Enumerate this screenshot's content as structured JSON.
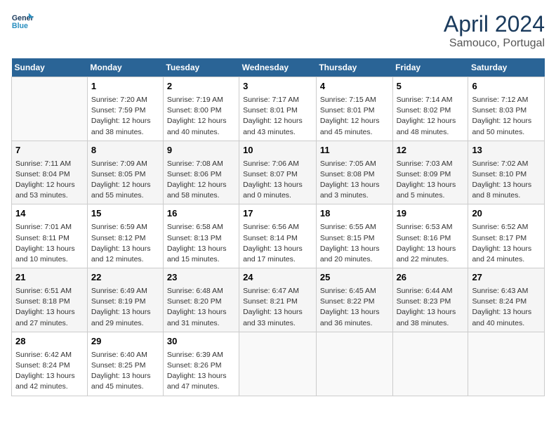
{
  "header": {
    "logo_line1": "General",
    "logo_line2": "Blue",
    "month": "April 2024",
    "location": "Samouco, Portugal"
  },
  "columns": [
    "Sunday",
    "Monday",
    "Tuesday",
    "Wednesday",
    "Thursday",
    "Friday",
    "Saturday"
  ],
  "rows": [
    [
      {
        "day": "",
        "info": ""
      },
      {
        "day": "1",
        "info": "Sunrise: 7:20 AM\nSunset: 7:59 PM\nDaylight: 12 hours\nand 38 minutes."
      },
      {
        "day": "2",
        "info": "Sunrise: 7:19 AM\nSunset: 8:00 PM\nDaylight: 12 hours\nand 40 minutes."
      },
      {
        "day": "3",
        "info": "Sunrise: 7:17 AM\nSunset: 8:01 PM\nDaylight: 12 hours\nand 43 minutes."
      },
      {
        "day": "4",
        "info": "Sunrise: 7:15 AM\nSunset: 8:01 PM\nDaylight: 12 hours\nand 45 minutes."
      },
      {
        "day": "5",
        "info": "Sunrise: 7:14 AM\nSunset: 8:02 PM\nDaylight: 12 hours\nand 48 minutes."
      },
      {
        "day": "6",
        "info": "Sunrise: 7:12 AM\nSunset: 8:03 PM\nDaylight: 12 hours\nand 50 minutes."
      }
    ],
    [
      {
        "day": "7",
        "info": "Sunrise: 7:11 AM\nSunset: 8:04 PM\nDaylight: 12 hours\nand 53 minutes."
      },
      {
        "day": "8",
        "info": "Sunrise: 7:09 AM\nSunset: 8:05 PM\nDaylight: 12 hours\nand 55 minutes."
      },
      {
        "day": "9",
        "info": "Sunrise: 7:08 AM\nSunset: 8:06 PM\nDaylight: 12 hours\nand 58 minutes."
      },
      {
        "day": "10",
        "info": "Sunrise: 7:06 AM\nSunset: 8:07 PM\nDaylight: 13 hours\nand 0 minutes."
      },
      {
        "day": "11",
        "info": "Sunrise: 7:05 AM\nSunset: 8:08 PM\nDaylight: 13 hours\nand 3 minutes."
      },
      {
        "day": "12",
        "info": "Sunrise: 7:03 AM\nSunset: 8:09 PM\nDaylight: 13 hours\nand 5 minutes."
      },
      {
        "day": "13",
        "info": "Sunrise: 7:02 AM\nSunset: 8:10 PM\nDaylight: 13 hours\nand 8 minutes."
      }
    ],
    [
      {
        "day": "14",
        "info": "Sunrise: 7:01 AM\nSunset: 8:11 PM\nDaylight: 13 hours\nand 10 minutes."
      },
      {
        "day": "15",
        "info": "Sunrise: 6:59 AM\nSunset: 8:12 PM\nDaylight: 13 hours\nand 12 minutes."
      },
      {
        "day": "16",
        "info": "Sunrise: 6:58 AM\nSunset: 8:13 PM\nDaylight: 13 hours\nand 15 minutes."
      },
      {
        "day": "17",
        "info": "Sunrise: 6:56 AM\nSunset: 8:14 PM\nDaylight: 13 hours\nand 17 minutes."
      },
      {
        "day": "18",
        "info": "Sunrise: 6:55 AM\nSunset: 8:15 PM\nDaylight: 13 hours\nand 20 minutes."
      },
      {
        "day": "19",
        "info": "Sunrise: 6:53 AM\nSunset: 8:16 PM\nDaylight: 13 hours\nand 22 minutes."
      },
      {
        "day": "20",
        "info": "Sunrise: 6:52 AM\nSunset: 8:17 PM\nDaylight: 13 hours\nand 24 minutes."
      }
    ],
    [
      {
        "day": "21",
        "info": "Sunrise: 6:51 AM\nSunset: 8:18 PM\nDaylight: 13 hours\nand 27 minutes."
      },
      {
        "day": "22",
        "info": "Sunrise: 6:49 AM\nSunset: 8:19 PM\nDaylight: 13 hours\nand 29 minutes."
      },
      {
        "day": "23",
        "info": "Sunrise: 6:48 AM\nSunset: 8:20 PM\nDaylight: 13 hours\nand 31 minutes."
      },
      {
        "day": "24",
        "info": "Sunrise: 6:47 AM\nSunset: 8:21 PM\nDaylight: 13 hours\nand 33 minutes."
      },
      {
        "day": "25",
        "info": "Sunrise: 6:45 AM\nSunset: 8:22 PM\nDaylight: 13 hours\nand 36 minutes."
      },
      {
        "day": "26",
        "info": "Sunrise: 6:44 AM\nSunset: 8:23 PM\nDaylight: 13 hours\nand 38 minutes."
      },
      {
        "day": "27",
        "info": "Sunrise: 6:43 AM\nSunset: 8:24 PM\nDaylight: 13 hours\nand 40 minutes."
      }
    ],
    [
      {
        "day": "28",
        "info": "Sunrise: 6:42 AM\nSunset: 8:24 PM\nDaylight: 13 hours\nand 42 minutes."
      },
      {
        "day": "29",
        "info": "Sunrise: 6:40 AM\nSunset: 8:25 PM\nDaylight: 13 hours\nand 45 minutes."
      },
      {
        "day": "30",
        "info": "Sunrise: 6:39 AM\nSunset: 8:26 PM\nDaylight: 13 hours\nand 47 minutes."
      },
      {
        "day": "",
        "info": ""
      },
      {
        "day": "",
        "info": ""
      },
      {
        "day": "",
        "info": ""
      },
      {
        "day": "",
        "info": ""
      }
    ]
  ]
}
